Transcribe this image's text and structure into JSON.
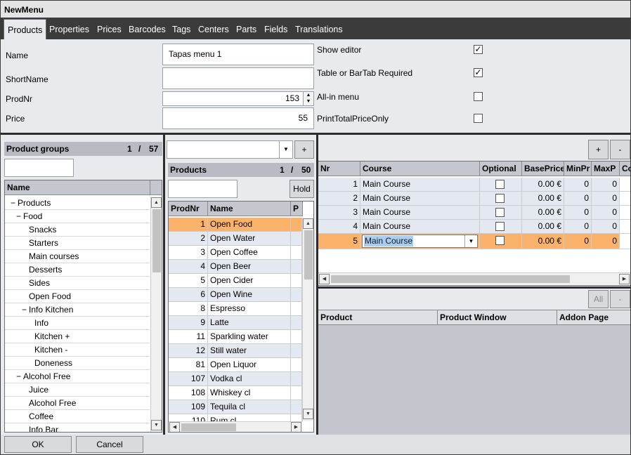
{
  "window": {
    "title": "NewMenu"
  },
  "tabs": [
    "Products",
    "Properties",
    "Prices",
    "Barcodes",
    "Tags",
    "Centers",
    "Parts",
    "Fields",
    "Translations"
  ],
  "form": {
    "name_label": "Name",
    "name_value": "Tapas menu 1",
    "shortname_label": "ShortName",
    "shortname_value": "",
    "prodnr_label": "ProdNr",
    "prodnr_value": "153",
    "price_label": "Price",
    "price_value": "55",
    "show_editor_label": "Show editor",
    "show_editor_checked": "✓",
    "table_required_label": "Table or BarTab Required",
    "table_required_checked": "✓",
    "allin_label": "All-in menu",
    "allin_checked": "",
    "print_total_label": "PrintTotalPriceOnly",
    "print_total_checked": ""
  },
  "product_groups": {
    "title": "Product groups",
    "page": "1",
    "sep": "/",
    "total": "57",
    "column": "Name",
    "items": [
      {
        "label": "Products",
        "indent": 0,
        "toggle": "−"
      },
      {
        "label": "Food",
        "indent": 1,
        "toggle": "−"
      },
      {
        "label": "Snacks",
        "indent": 2,
        "toggle": ""
      },
      {
        "label": "Starters",
        "indent": 2,
        "toggle": ""
      },
      {
        "label": "Main courses",
        "indent": 2,
        "toggle": ""
      },
      {
        "label": "Desserts",
        "indent": 2,
        "toggle": ""
      },
      {
        "label": "Sides",
        "indent": 2,
        "toggle": ""
      },
      {
        "label": "Open Food",
        "indent": 2,
        "toggle": ""
      },
      {
        "label": "Info Kitchen",
        "indent": 2,
        "toggle": "−"
      },
      {
        "label": "Info",
        "indent": 3,
        "toggle": ""
      },
      {
        "label": "Kitchen +",
        "indent": 3,
        "toggle": ""
      },
      {
        "label": "Kitchen -",
        "indent": 3,
        "toggle": ""
      },
      {
        "label": "Doneness",
        "indent": 3,
        "toggle": ""
      },
      {
        "label": "Alcohol Free",
        "indent": 1,
        "toggle": "−"
      },
      {
        "label": "Juice",
        "indent": 2,
        "toggle": ""
      },
      {
        "label": "Alcohol Free",
        "indent": 2,
        "toggle": ""
      },
      {
        "label": "Coffee",
        "indent": 2,
        "toggle": ""
      },
      {
        "label": "Info Bar",
        "indent": 2,
        "toggle": ""
      }
    ]
  },
  "products": {
    "title": "Products",
    "page": "1",
    "sep": "/",
    "total": "50",
    "add_label": "+",
    "hold_label": "Hold",
    "columns": [
      "ProdNr",
      "Name",
      "P"
    ],
    "rows": [
      {
        "nr": "1",
        "name": "Open Food"
      },
      {
        "nr": "2",
        "name": "Open Water"
      },
      {
        "nr": "3",
        "name": "Open Coffee"
      },
      {
        "nr": "4",
        "name": "Open Beer"
      },
      {
        "nr": "5",
        "name": "Open Cider"
      },
      {
        "nr": "6",
        "name": "Open Wine"
      },
      {
        "nr": "8",
        "name": "Espresso"
      },
      {
        "nr": "9",
        "name": "Latte"
      },
      {
        "nr": "11",
        "name": "Sparkling water"
      },
      {
        "nr": "12",
        "name": "Still water"
      },
      {
        "nr": "81",
        "name": "Open Liquor"
      },
      {
        "nr": "107",
        "name": "Vodka cl"
      },
      {
        "nr": "108",
        "name": "Whiskey cl"
      },
      {
        "nr": "109",
        "name": "Tequila cl"
      },
      {
        "nr": "110",
        "name": "Rum cl"
      }
    ]
  },
  "courses": {
    "add_label": "+",
    "remove_label": "-",
    "columns": [
      "Nr",
      "Course",
      "Optional",
      "BasePrice",
      "MinPr",
      "MaxP",
      "Co"
    ],
    "rows": [
      {
        "nr": "1",
        "course": "Main Course",
        "price": "0.00 €",
        "min": "0",
        "max": "0"
      },
      {
        "nr": "2",
        "course": "Main Course",
        "price": "0.00 €",
        "min": "0",
        "max": "0"
      },
      {
        "nr": "3",
        "course": "Main Course",
        "price": "0.00 €",
        "min": "0",
        "max": "0"
      },
      {
        "nr": "4",
        "course": "Main Course",
        "price": "0.00 €",
        "min": "0",
        "max": "0"
      },
      {
        "nr": "5",
        "course": "Main Course",
        "price": "0.00 €",
        "min": "0",
        "max": "0"
      }
    ]
  },
  "addons": {
    "all_label": "All",
    "remove_label": "-",
    "columns": [
      "Product",
      "Product Window",
      "Addon Page"
    ]
  },
  "footer": {
    "ok_label": "OK",
    "cancel_label": "Cancel"
  }
}
